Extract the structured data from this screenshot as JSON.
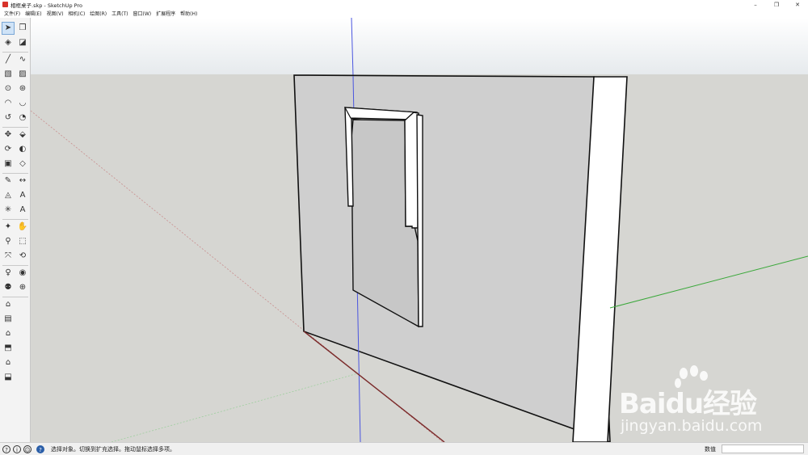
{
  "window": {
    "title": "相框桌子.skp - SketchUp Pro",
    "controls": [
      "–",
      "❐",
      "✕"
    ]
  },
  "menu": [
    "文件(F)",
    "编辑(E)",
    "视图(V)",
    "相机(C)",
    "绘图(R)",
    "工具(T)",
    "窗口(W)",
    "扩展程序",
    "帮助(H)"
  ],
  "toolbar": {
    "rows": [
      [
        "select-tool-icon",
        "component-tool-icon"
      ],
      [
        "paint-bucket-icon",
        "eraser-icon"
      ],
      [
        "line-tool-icon",
        "freehand-icon"
      ],
      [
        "rectangle-icon",
        "rotated-rectangle-icon"
      ],
      [
        "circle-icon",
        "polygon-icon"
      ],
      [
        "arc-icon",
        "two-point-arc-icon"
      ],
      [
        "three-point-arc-icon",
        "pie-icon"
      ],
      [
        "move-icon",
        "push-pull-icon"
      ],
      [
        "rotate-icon",
        "follow-me-icon"
      ],
      [
        "scale-icon",
        "offset-icon"
      ],
      [
        "tape-measure-icon",
        "dimension-icon"
      ],
      [
        "protractor-icon",
        "text-icon"
      ],
      [
        "axes-icon",
        "3d-text-icon"
      ],
      [
        "orbit-icon",
        "pan-icon"
      ],
      [
        "zoom-icon",
        "zoom-window-icon"
      ],
      [
        "zoom-extents-icon",
        "previous-view-icon"
      ],
      [
        "position-camera-icon",
        "look-around-icon"
      ],
      [
        "walk-icon",
        "section-plane-icon"
      ],
      [
        "warehouse-icon"
      ],
      [
        "components-icon"
      ],
      [
        "extension-warehouse-icon"
      ],
      [
        "layout-icon"
      ],
      [
        "send-to-layout-icon"
      ],
      [
        "extension-manager-icon"
      ]
    ],
    "glyphs": [
      "➤",
      "❒",
      "◈",
      "◪",
      "╱",
      "∿",
      "▧",
      "▨",
      "⊙",
      "⊛",
      "◠",
      "◡",
      "↺",
      "◔",
      "✥",
      "⬙",
      "⟳",
      "◐",
      "▣",
      "◇",
      "✎",
      "↔",
      "◬",
      "A",
      "✳",
      "A",
      "✦",
      "✋",
      "⚲",
      "⬚",
      "⤧",
      "⟲",
      "♀",
      "◉",
      "⚉",
      "⊕",
      "⌂",
      "▤",
      "⌂",
      "⬒",
      "⌂",
      "⬓"
    ],
    "active_index": 0
  },
  "status": {
    "text": "选择对象。切换到扩充选择。拖动鼠标选择多项。",
    "measure_label": "数值",
    "measure_value": ""
  },
  "watermark": {
    "brand": "Baidu经验",
    "sub": "jingyan.baidu.com"
  },
  "colors": {
    "sky": "#e9edf0",
    "ground": "#d6d6d2",
    "wall": "#cfcfcf",
    "red_axis": "#c24b4b",
    "green_axis": "#3aa83a",
    "blue_axis": "#3b46d6"
  }
}
